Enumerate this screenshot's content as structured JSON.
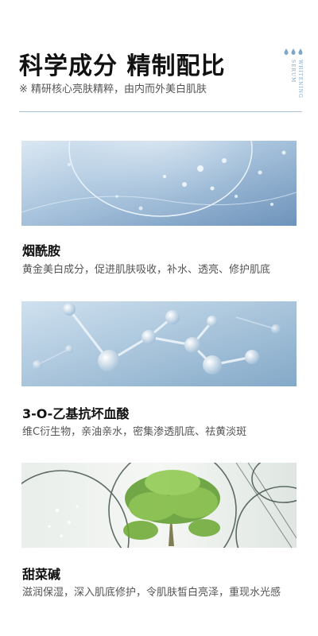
{
  "header": {
    "title": "科学成分 精制配比",
    "subtitle": "※ 精研核心亮肤精粹，由内而外美白肌肤",
    "side_label": "WHITENING SERUM",
    "accent_color": "#7fa7c9",
    "drop_icon": "water-drop-icon"
  },
  "ingredients": [
    {
      "title": "烟酰胺",
      "description": "黄金美白成分，促进肌肤吸收，补水、透亮、修护肌底"
    },
    {
      "title": "3-O-乙基抗坏血酸",
      "description": "维C衍生物，亲油亲水，密集渗透肌底、祛黄淡斑"
    },
    {
      "title": "甜菜碱",
      "description": "滋润保湿，深入肌底修护，令肌肤皙白亮泽，重现水光感"
    }
  ]
}
